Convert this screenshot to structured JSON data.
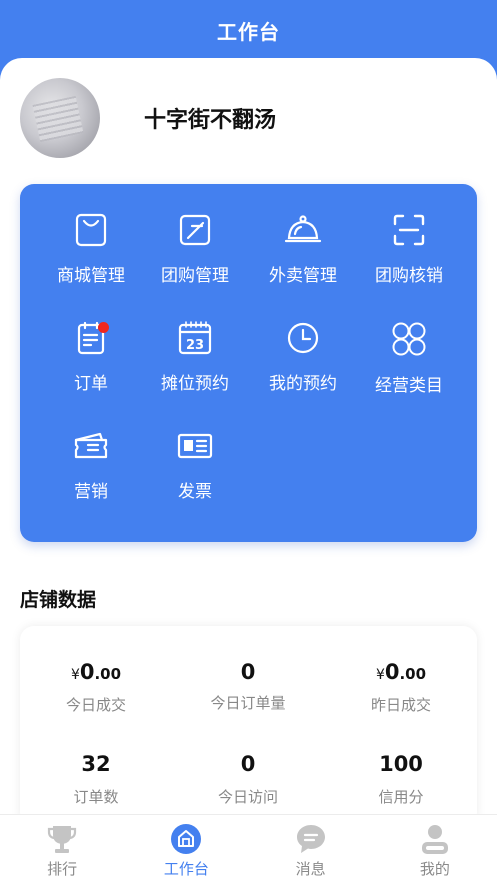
{
  "header": {
    "title": "工作台"
  },
  "profile": {
    "shop_name": "十字街不翻汤"
  },
  "menu": {
    "items": [
      {
        "label": "商城管理",
        "icon": "shopping-bag-icon"
      },
      {
        "label": "团购管理",
        "icon": "edit-square-icon"
      },
      {
        "label": "外卖管理",
        "icon": "food-cloche-icon"
      },
      {
        "label": "团购核销",
        "icon": "scan-icon"
      },
      {
        "label": "订单",
        "icon": "order-clipboard-icon",
        "badge": true
      },
      {
        "label": "摊位预约",
        "icon": "calendar-icon",
        "calendar_day": "23"
      },
      {
        "label": "我的预约",
        "icon": "clock-icon"
      },
      {
        "label": "经营类目",
        "icon": "category-grid-icon"
      },
      {
        "label": "营销",
        "icon": "ticket-icon"
      },
      {
        "label": "发票",
        "icon": "invoice-icon"
      }
    ]
  },
  "store_data": {
    "title": "店铺数据",
    "currency": "¥",
    "stats": [
      {
        "int": "0",
        "dec": ".00",
        "money": true,
        "label": "今日成交"
      },
      {
        "int": "0",
        "dec": "",
        "money": false,
        "label": "今日订单量"
      },
      {
        "int": "0",
        "dec": ".00",
        "money": true,
        "label": "昨日成交"
      },
      {
        "int": "32",
        "dec": "",
        "money": false,
        "label": "订单数"
      },
      {
        "int": "0",
        "dec": "",
        "money": false,
        "label": "今日访问"
      },
      {
        "int": "100",
        "dec": "",
        "money": false,
        "label": "信用分"
      }
    ]
  },
  "tabbar": {
    "items": [
      {
        "label": "排行",
        "icon": "trophy-icon",
        "active": false
      },
      {
        "label": "工作台",
        "icon": "workbench-icon",
        "active": true
      },
      {
        "label": "消息",
        "icon": "message-icon",
        "active": false
      },
      {
        "label": "我的",
        "icon": "user-icon",
        "active": false
      }
    ]
  },
  "colors": {
    "primary": "#4480ef",
    "badge": "#f0271e",
    "inactive_tab": "#c4c4c4"
  }
}
